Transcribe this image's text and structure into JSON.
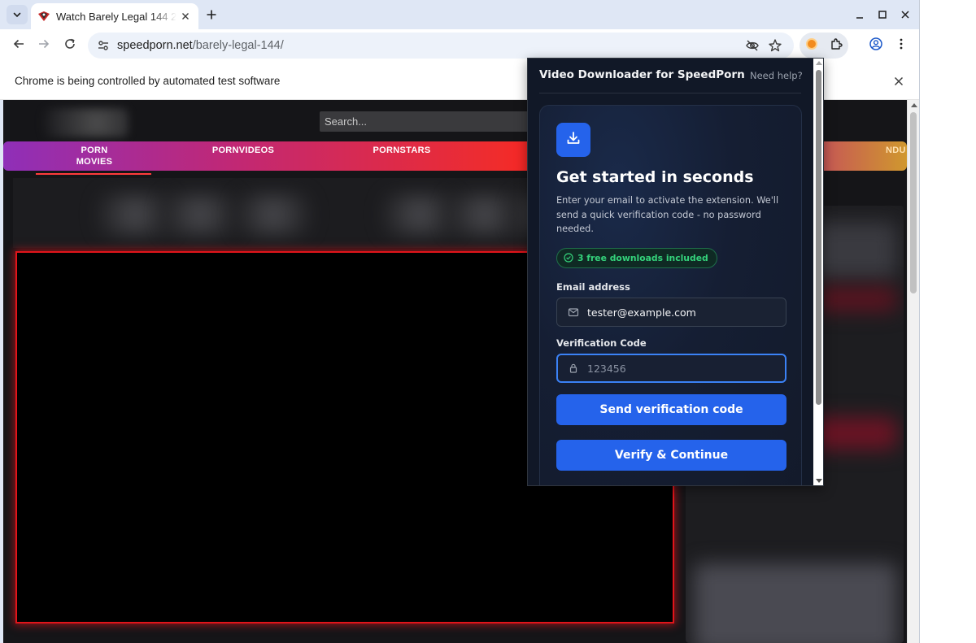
{
  "browser": {
    "tab": {
      "title": "Watch Barely Legal 144 2",
      "close_label": "×"
    },
    "new_tab_label": "+",
    "address": {
      "host": "speedporn.net",
      "path": "/barely-legal-144/"
    },
    "infobar": {
      "text": "Chrome is being controlled by automated test software"
    }
  },
  "page": {
    "search_placeholder": "Search...",
    "nav": [
      {
        "label": "PORN\nMOVIES"
      },
      {
        "label": "PORNVIDEOS"
      },
      {
        "label": "PORNSTARS"
      }
    ],
    "nav_partial": "NDU"
  },
  "popup": {
    "title": "Video Downloader for SpeedPorn",
    "help": "Need help?",
    "heading": "Get started in seconds",
    "description": "Enter your email to activate the extension. We'll send a quick verification code - no password needed.",
    "free_badge": "3 free downloads included",
    "email_label": "Email address",
    "email_value": "tester@example.com",
    "code_label": "Verification Code",
    "code_placeholder": "123456",
    "send_button": "Send verification code",
    "verify_button": "Verify & Continue"
  },
  "colors": {
    "accent": "#2563eb",
    "success": "#34d27b",
    "popup_bg": "#111827",
    "player_border": "#e1141a"
  },
  "icons": {
    "tab_search": "chevron-down-icon",
    "favicon": "site-favicon-icon",
    "back": "back-arrow-icon",
    "forward": "forward-arrow-icon",
    "reload": "reload-icon",
    "site_info": "tune-icon",
    "tracking": "eye-off-icon",
    "bookmark": "star-icon",
    "extension": "orange-extension-icon",
    "extensions_menu": "puzzle-icon",
    "profile": "profile-icon",
    "menu": "kebab-menu-icon",
    "download": "download-icon",
    "check": "check-circle-icon",
    "mail": "mail-icon",
    "lock": "lock-icon"
  }
}
